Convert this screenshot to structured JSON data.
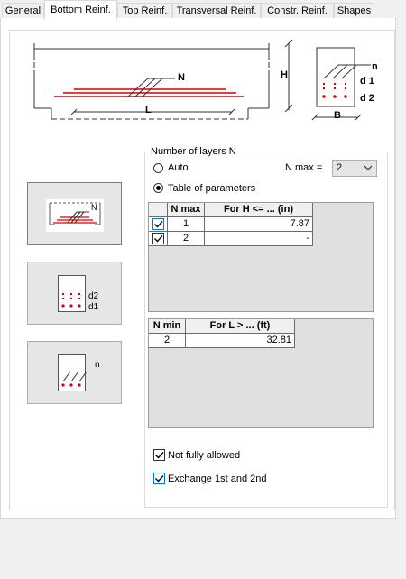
{
  "tabs": [
    {
      "label": "General"
    },
    {
      "label": "Bottom Reinf."
    },
    {
      "label": "Top Reinf."
    },
    {
      "label": "Transversal Reinf."
    },
    {
      "label": "Constr. Reinf."
    },
    {
      "label": "Shapes"
    }
  ],
  "diagram": {
    "beam_label_N": "N",
    "beam_label_H": "H",
    "beam_label_L": "L",
    "section_label_n": "n",
    "section_label_d1": "d 1",
    "section_label_d2": "d 2",
    "section_label_B": "B"
  },
  "pic_buttons": {
    "layers_label_N": "N",
    "distance_label_d2": "d2",
    "distance_label_d1": "d1",
    "bars_label_n": "n"
  },
  "layers_group": {
    "title": "Number of layers N",
    "auto_label": "Auto",
    "auto_selected": false,
    "table_label": "Table of parameters",
    "table_selected": true,
    "nmax_label": "N max =",
    "nmax_value": "2"
  },
  "table_h": {
    "headers": [
      "N max",
      "For H <= ... (in)"
    ],
    "rows": [
      {
        "checked": true,
        "n": "1",
        "value": "7.87"
      },
      {
        "checked": true,
        "n": "2",
        "value": "-"
      }
    ]
  },
  "table_l": {
    "headers": [
      "N min",
      "For L > ... (ft)"
    ],
    "rows": [
      {
        "n": "2",
        "value": "32.81"
      }
    ]
  },
  "options": {
    "not_fully_allowed_label": "Not fully allowed",
    "not_fully_allowed_checked": true,
    "exchange_label": "Exchange 1st and 2nd",
    "exchange_checked": true
  },
  "colors": {
    "bar_red": "#d80000",
    "accent_blue": "#0078d7"
  }
}
